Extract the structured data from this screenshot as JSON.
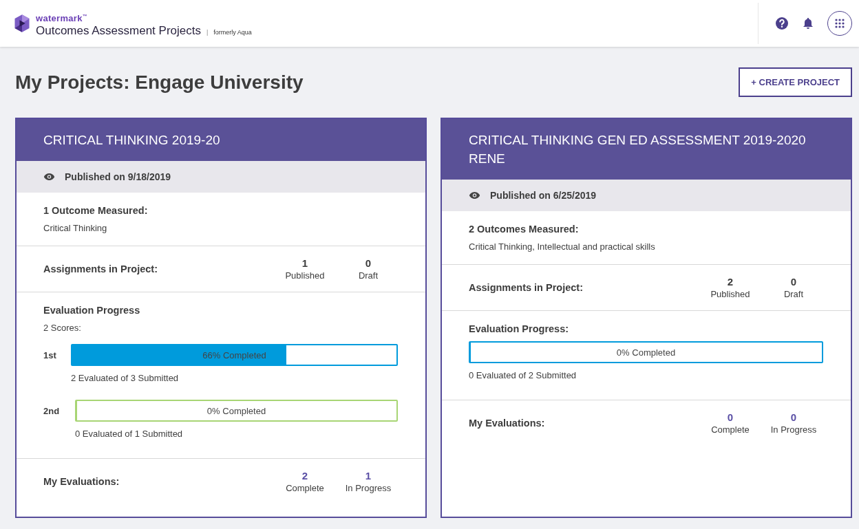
{
  "header": {
    "brand": "watermark",
    "brand_mark": "™",
    "product": "Outcomes Assessment Projects",
    "separator": "|",
    "subtitle": "formerly Aqua"
  },
  "page_title": "My Projects: Engage University",
  "create_button": "+ CREATE PROJECT",
  "projects": [
    {
      "title": "CRITICAL THINKING 2019-20",
      "published": "Published on 9/18/2019",
      "outcomes_heading": "1 Outcome Measured:",
      "outcomes": "Critical Thinking",
      "assignments": {
        "label": "Assignments in Project:",
        "stats": [
          {
            "value": "1",
            "label": "Published"
          },
          {
            "value": "0",
            "label": "Draft"
          }
        ]
      },
      "progress": {
        "heading": "Evaluation Progress",
        "scores_label": "2 Scores:",
        "bars": [
          {
            "label": "1st",
            "level": 0.66,
            "color": "#009bdc",
            "text": "66% Completed",
            "detail": "2 Evaluated of 3 Submitted"
          },
          {
            "label": "2nd",
            "level": 0,
            "color": "#a8d574",
            "text": "0% Completed",
            "detail": "0 Evaluated of 1 Submitted"
          }
        ]
      },
      "evaluations": {
        "label": "My Evaluations:",
        "stats": [
          {
            "value": "2",
            "label": "Complete"
          },
          {
            "value": "1",
            "label": "In Progress"
          }
        ]
      }
    },
    {
      "title": "CRITICAL THINKING GEN ED ASSESSMENT 2019-2020 RENE",
      "published": "Published on 6/25/2019",
      "outcomes_heading": "2 Outcomes Measured:",
      "outcomes": "Critical Thinking, Intellectual and practical skills",
      "assignments": {
        "label": "Assignments in Project:",
        "stats": [
          {
            "value": "2",
            "label": "Published"
          },
          {
            "value": "0",
            "label": "Draft"
          }
        ]
      },
      "progress": {
        "heading": "Evaluation Progress:",
        "bars": [
          {
            "level": 0,
            "color": "#009bdc",
            "text": "0% Completed",
            "detail": "0 Evaluated of 2 Submitted"
          }
        ]
      },
      "evaluations": {
        "label": "My Evaluations:",
        "stats": [
          {
            "value": "0",
            "label": "Complete"
          },
          {
            "value": "0",
            "label": "In Progress"
          }
        ]
      }
    }
  ]
}
